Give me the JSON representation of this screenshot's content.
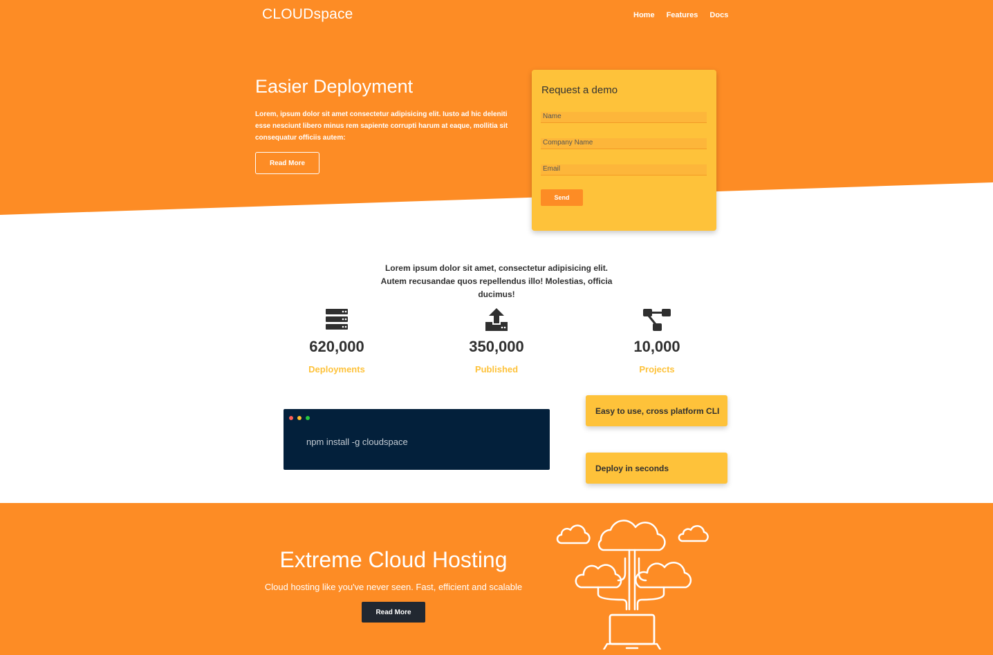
{
  "brand": {
    "logo": "CLOUDspace"
  },
  "nav": {
    "items": [
      "Home",
      "Features",
      "Docs"
    ]
  },
  "hero": {
    "title": "Easier Deployment",
    "text": "Lorem, ipsum dolor sit amet consectetur adipisicing elit. Iusto ad hic deleniti esse nesciunt libero minus rem sapiente corrupti harum at eaque, mollitia sit consequatur officiis autem:",
    "button": "Read More"
  },
  "demo": {
    "title": "Request a demo",
    "fields": {
      "name": "Name",
      "company": "Company Name",
      "email": "Email"
    },
    "button": "Send"
  },
  "intro": "Lorem ipsum dolor sit amet, consectetur adipisicing elit. Autem recusandae quos repellendus illo! Molestias, officia ducimus!",
  "stats": [
    {
      "value": "620,000",
      "label": "Deployments",
      "icon": "server-icon"
    },
    {
      "value": "350,000",
      "label": "Published",
      "icon": "upload-icon"
    },
    {
      "value": "10,000",
      "label": "Projects",
      "icon": "project-diagram-icon"
    }
  ],
  "terminal": {
    "command": "npm install -g cloudspace"
  },
  "features": [
    "Easy to use, cross platform CLI",
    "Deploy in seconds"
  ],
  "bottom": {
    "title": "Extreme Cloud Hosting",
    "subtitle": "Cloud hosting like you've never seen. Fast, efficient and scalable",
    "button": "Read More"
  },
  "colors": {
    "orange": "#fd8c25",
    "yellow": "#fec23a",
    "terminal": "#03203b",
    "dark": "#222831"
  }
}
